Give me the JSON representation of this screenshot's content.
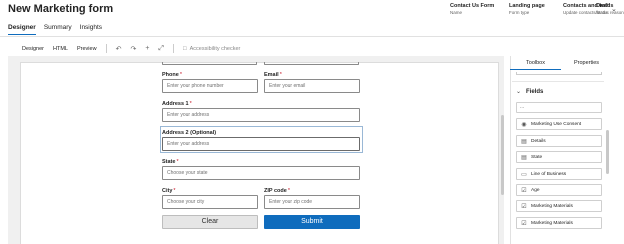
{
  "form": {
    "title": "New Marketing form"
  },
  "header_meta": [
    {
      "value": "Contact Us Form",
      "label": "Name"
    },
    {
      "value": "Landing page",
      "label": "Form type"
    },
    {
      "value": "Contacts and leads",
      "label": "Update contacts/leads"
    },
    {
      "value": "Draft",
      "label": "Status reason"
    }
  ],
  "tabs": [
    "Designer",
    "Summary",
    "Insights"
  ],
  "toolbar": {
    "designer": "Designer",
    "html": "HTML",
    "preview": "Preview",
    "accessibility": "Accessibility checker"
  },
  "fields": {
    "phone": {
      "label": "Phone",
      "required": "*",
      "placeholder": "Enter your phone number"
    },
    "email": {
      "label": "Email",
      "required": "*",
      "placeholder": "Enter your email"
    },
    "address1": {
      "label": "Address 1",
      "required": "*",
      "placeholder": "Enter your address"
    },
    "address2": {
      "label": "Address 2 (Optional)",
      "placeholder": "Enter your address"
    },
    "state": {
      "label": "State",
      "required": "*",
      "placeholder": "Choose your state"
    },
    "city": {
      "label": "City",
      "required": "*",
      "placeholder": "Choose your city"
    },
    "zip": {
      "label": "ZIP code",
      "required": "*",
      "placeholder": "Enter your zip code"
    }
  },
  "buttons": {
    "clear": "Clear",
    "submit": "Submit"
  },
  "panel": {
    "tabs": [
      "Toolbox",
      "Properties"
    ],
    "section": "Fields",
    "search_text": "...",
    "items": [
      {
        "icon": "radio-icon",
        "label": "Marketing Use Consent"
      },
      {
        "icon": "text-area-icon",
        "label": "Details"
      },
      {
        "icon": "list-icon",
        "label": "State"
      },
      {
        "icon": "text-line-icon",
        "label": "Line of Business"
      },
      {
        "icon": "check-icon",
        "label": "Age"
      },
      {
        "icon": "check-icon",
        "label": "Marketing Materials"
      },
      {
        "icon": "check-icon",
        "label": "Marketing Materials"
      }
    ]
  }
}
